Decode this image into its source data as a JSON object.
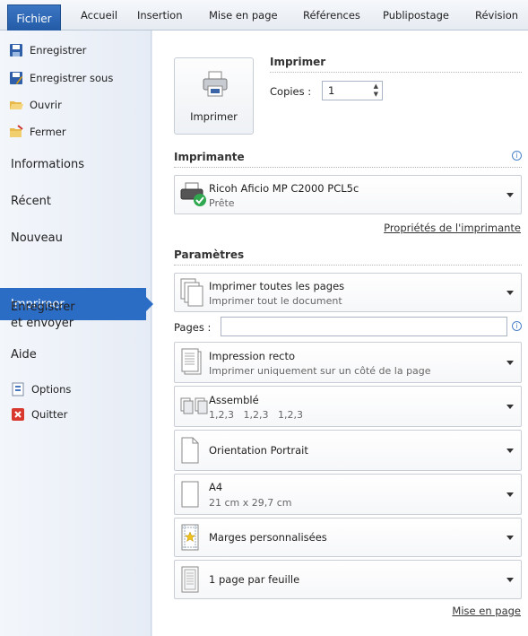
{
  "ribbon": {
    "file": "Fichier",
    "tabs": [
      "Accueil",
      "Insertion",
      "Mise en page",
      "Références",
      "Publipostage",
      "Révision"
    ]
  },
  "left_menu": {
    "save": "Enregistrer",
    "save_as": "Enregistrer sous",
    "open": "Ouvrir",
    "close": "Fermer",
    "info": "Informations",
    "recent": "Récent",
    "new": "Nouveau",
    "print": "Imprimer",
    "send_line1": "Enregistrer",
    "send_line2": "et envoyer",
    "help": "Aide",
    "options": "Options",
    "quit": "Quitter"
  },
  "print": {
    "button_label": "Imprimer",
    "section_title": "Imprimer",
    "copies_label": "Copies :",
    "copies_value": "1"
  },
  "printer": {
    "title": "Imprimante",
    "name": "Ricoh Aficio MP C2000 PCL5c",
    "status": "Prête",
    "properties_link": "Propriétés de l'imprimante"
  },
  "settings": {
    "title": "Paramètres",
    "range_main": "Imprimer toutes les pages",
    "range_sub": "Imprimer tout le document",
    "pages_label": "Pages :",
    "sides_main": "Impression recto",
    "sides_sub": "Imprimer uniquement sur un côté de la page",
    "collate_main": "Assemblé",
    "collate_sub": "1,2,3   1,2,3   1,2,3",
    "orientation": "Orientation Portrait",
    "paper_main": "A4",
    "paper_sub": "21 cm x 29,7 cm",
    "margins": "Marges personnalisées",
    "per_sheet": "1 page par feuille",
    "page_setup_link": "Mise en page"
  },
  "colors": {
    "accent": "#2b6cc4",
    "ribbon_file": "#2a62ad"
  }
}
